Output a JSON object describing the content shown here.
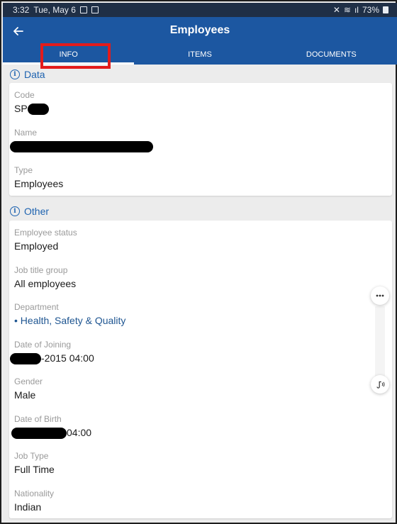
{
  "status_bar": {
    "time": "3:32",
    "date": "Tue, May 6",
    "battery": "73%"
  },
  "app_bar": {
    "title": "Employees"
  },
  "tabs": [
    {
      "label": "INFO"
    },
    {
      "label": "ITEMS"
    },
    {
      "label": "DOCUMENTS"
    }
  ],
  "sections": {
    "data": {
      "title": "Data",
      "fields": {
        "code": {
          "label": "Code",
          "value": "SP"
        },
        "name": {
          "label": "Name"
        },
        "type": {
          "label": "Type",
          "value": "Employees"
        }
      }
    },
    "other": {
      "title": "Other",
      "fields": {
        "employee_status": {
          "label": "Employee status",
          "value": "Employed"
        },
        "job_title_group": {
          "label": "Job title group",
          "value": "All employees"
        },
        "department": {
          "label": "Department",
          "value": "• Health, Safety & Quality"
        },
        "date_of_joining": {
          "label": "Date of Joining",
          "value": "-2015 04:00"
        },
        "gender": {
          "label": "Gender",
          "value": "Male"
        },
        "date_of_birth": {
          "label": "Date of Birth",
          "value": "04:00"
        },
        "job_type": {
          "label": "Job Type",
          "value": "Full Time"
        },
        "nationality": {
          "label": "Nationality",
          "value": "Indian"
        }
      }
    }
  },
  "icons": [
    "back-arrow-icon",
    "info-icon",
    "more-dots-icon",
    "audio-icon",
    "image-icon",
    "wifi-icon",
    "battery-icon"
  ],
  "colors": {
    "primary": "#1c57a1",
    "accent_text": "#1e63b0",
    "highlight": "#e31b1b"
  }
}
